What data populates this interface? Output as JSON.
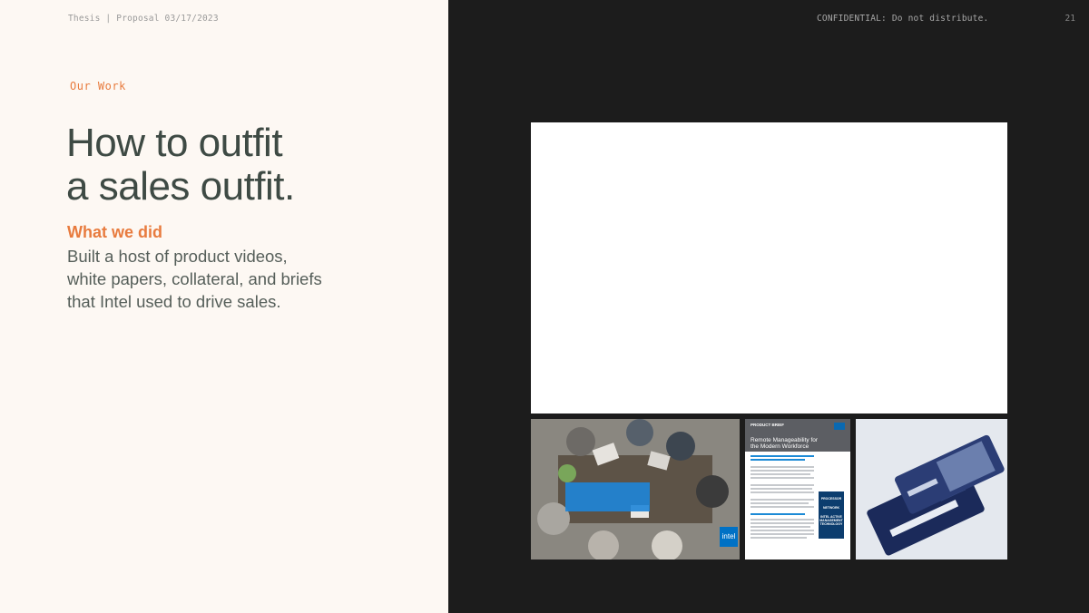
{
  "header": {
    "left": "Thesis | Proposal 03/17/2023",
    "right": "CONFIDENTIAL: Do not distribute.",
    "page_number": "21"
  },
  "section_label": "Our Work",
  "title_line1": "How to outfit",
  "title_line2": "a sales outfit.",
  "subheading": "What we did",
  "body_lines": [
    "Built a host of product videos,",
    "white papers, collateral, and briefs",
    "that Intel used to drive sales."
  ],
  "thumbnails": {
    "brief_tag": "PRODUCT BRIEF",
    "brief_title_line1": "Remote Manageability for",
    "brief_title_line2": "the Modern Workforce",
    "brief_side_labels": [
      "PROCESSOR",
      "NETWORK",
      "INTEL ACTIVE MANAGEMENT TECHNOLOGY"
    ],
    "photo_logo": "intel"
  },
  "colors": {
    "accent": "#e87b3e",
    "left_bg": "#fdf8f3",
    "right_bg": "#1c1c1c",
    "title": "#3e4a44"
  }
}
